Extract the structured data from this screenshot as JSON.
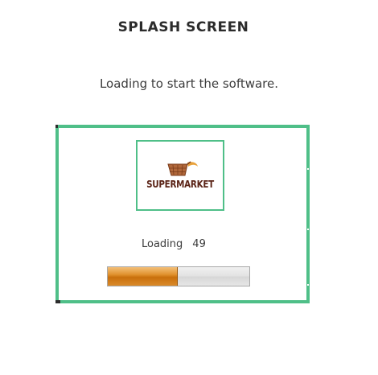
{
  "page": {
    "title": "SPLASH SCREEN",
    "subtitle": "Loading to start the software."
  },
  "splash": {
    "logo": {
      "brand_text": "SUPERMARKET",
      "icon": "shopping-cart-icon"
    },
    "loading_label": "Loading",
    "loading_value": "49",
    "progress_fraction": 0.49
  },
  "colors": {
    "frame_border": "#4fbf88",
    "progress_fill": "#d9841f",
    "brand_text": "#5a2316",
    "cart_basket": "#a05a2c",
    "swoosh": "#e8a13a"
  }
}
